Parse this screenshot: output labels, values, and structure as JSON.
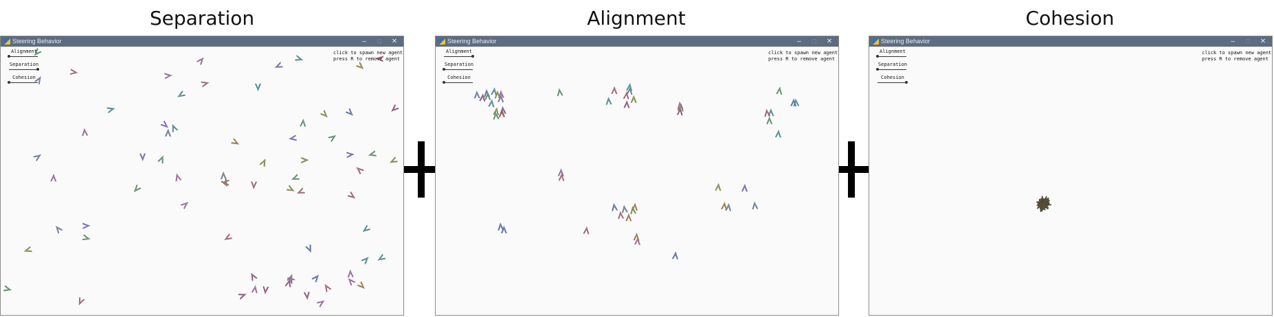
{
  "panels": [
    {
      "heading": "Separation",
      "window_title": "Steering Behavior",
      "controls": {
        "minimize": "–",
        "maximize": "□",
        "close": "✕"
      },
      "sliders": [
        {
          "label": "Alignment",
          "value": 0.0
        },
        {
          "label": "Separation",
          "value": 1.0
        },
        {
          "label": "Cohesion",
          "value": 0.0
        }
      ],
      "help": [
        "click to spawn new agent",
        "press R to remove agent"
      ]
    },
    {
      "heading": "Alignment",
      "window_title": "Steering Behavior",
      "controls": {
        "minimize": "–",
        "maximize": "□",
        "close": "✕"
      },
      "sliders": [
        {
          "label": "Alignment",
          "value": 1.0
        },
        {
          "label": "Separation",
          "value": 0.0
        },
        {
          "label": "Cohesion",
          "value": 0.0
        }
      ],
      "help": [
        "click to spawn new agent",
        "press R to remove agent"
      ]
    },
    {
      "heading": "Cohesion",
      "window_title": "Steering Behavior",
      "controls": {
        "minimize": "–",
        "maximize": "□",
        "close": "✕"
      },
      "sliders": [
        {
          "label": "Alignment",
          "value": 0.0
        },
        {
          "label": "Separation",
          "value": 0.0
        },
        {
          "label": "Cohesion",
          "value": 1.0
        }
      ],
      "help": [
        "click to spawn new agent",
        "press R to remove agent"
      ]
    }
  ],
  "operators": [
    "plus-sign",
    "plus-sign"
  ],
  "colors": {
    "titlebar": "#5d6c80",
    "canvas": "#fafafa",
    "text": "#111111"
  }
}
